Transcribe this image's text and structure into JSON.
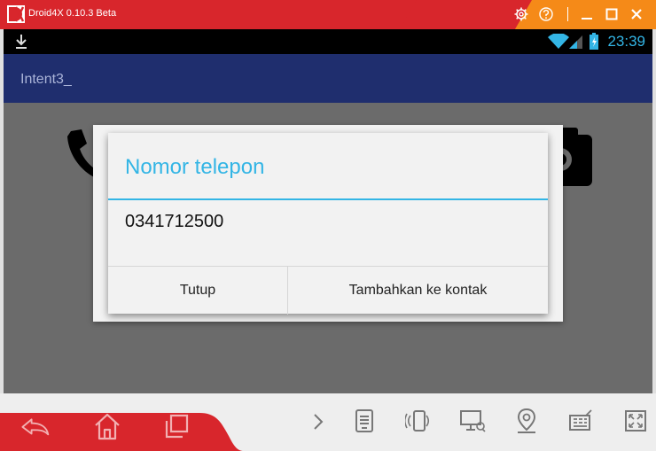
{
  "window": {
    "title": "Droid4X 0.10.3 Beta",
    "icons": [
      "gear-icon",
      "help-icon",
      "minimize-icon",
      "maximize-icon",
      "close-icon"
    ],
    "colors": {
      "titlebar_red": "#d8262c",
      "titlebar_orange": "#f58a18"
    }
  },
  "statusbar": {
    "time": "23:39",
    "icons": [
      "download-icon",
      "wifi-icon",
      "signal-icon",
      "battery-icon"
    ]
  },
  "app": {
    "title": "Intent3_",
    "background_icons": [
      "phone-icon",
      "camera-icon"
    ]
  },
  "dialog": {
    "title": "Nomor telepon",
    "number": "0341712500",
    "buttons": {
      "close": "Tutup",
      "add": "Tambahkan ke kontak"
    },
    "accent": "#33b5e5"
  },
  "toolbar": {
    "icons": [
      "back-icon",
      "home-icon",
      "recents-icon",
      "chevron-right-icon",
      "apk-icon",
      "shake-icon",
      "screen-icon",
      "location-icon",
      "keyboard-icon",
      "fullscreen-icon"
    ]
  }
}
